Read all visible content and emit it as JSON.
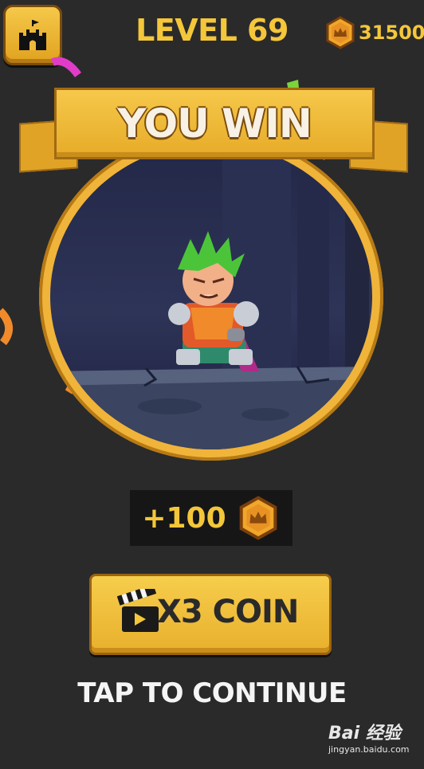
{
  "header": {
    "home_icon": "castle-icon",
    "level_title": "LEVEL 69",
    "coin_count": "31500",
    "coin_icon": "crown-coin-icon"
  },
  "banner": {
    "title": "YOU WIN"
  },
  "reward": {
    "amount": "+100",
    "coin_icon": "crown-coin-icon"
  },
  "bonus_button": {
    "label": "X3 COIN",
    "icon": "video-clapperboard-icon"
  },
  "footer": {
    "continue_label": "TAP TO CONTINUE"
  },
  "watermark": {
    "brand": "Bai 经验",
    "url": "jingyan.baidu.com"
  },
  "colors": {
    "background": "#2a2a2a",
    "gold": "#f4c63a",
    "banner_gold": "#f6c84a",
    "reward_bg": "#161616",
    "text_light": "#f5f5f5"
  }
}
